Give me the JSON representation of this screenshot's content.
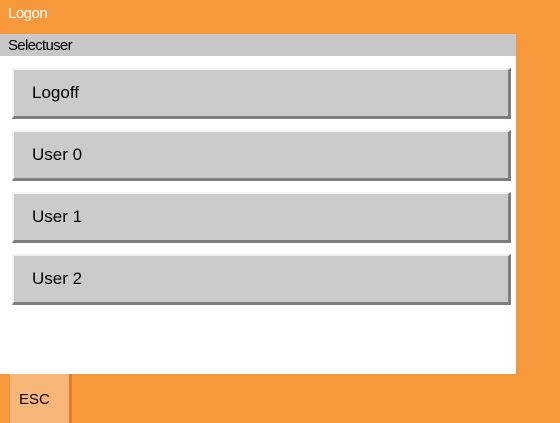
{
  "window": {
    "title": "Logon"
  },
  "panel": {
    "subtitle": "Selectuser"
  },
  "users": [
    {
      "label": "Logoff"
    },
    {
      "label": "User 0"
    },
    {
      "label": "User 1"
    },
    {
      "label": "User 2"
    }
  ],
  "footer": {
    "esc_label": "ESC"
  },
  "colors": {
    "accent": "#f7983b",
    "esc_button": "#fbb77a",
    "subtitle_bar": "#c8c8c8",
    "button_face": "#cbcbcb"
  }
}
